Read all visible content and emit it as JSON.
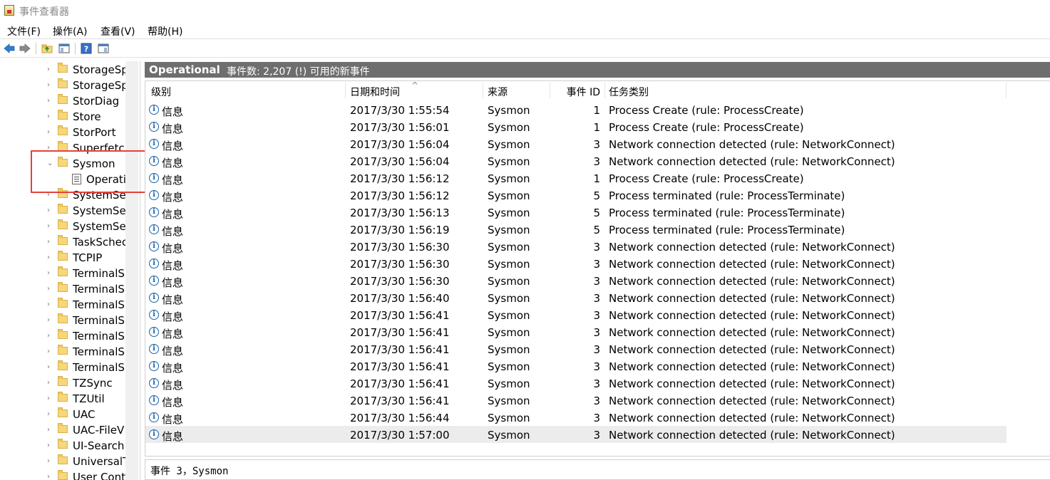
{
  "window": {
    "title": "事件查看器"
  },
  "menu": [
    "文件(F)",
    "操作(A)",
    "查看(V)",
    "帮助(H)"
  ],
  "toolbar": {
    "icons": [
      "back-arrow-icon",
      "forward-arrow-icon",
      "up-folder-icon",
      "show-hide-tree-icon",
      "help-icon",
      "show-hide-action-pane-icon"
    ]
  },
  "tree": {
    "items": [
      {
        "label": "StorageSp",
        "chevron": "›"
      },
      {
        "label": "StorageSp",
        "chevron": "›"
      },
      {
        "label": "StorDiag",
        "chevron": "›"
      },
      {
        "label": "Store",
        "chevron": "›"
      },
      {
        "label": "StorPort",
        "chevron": "›"
      },
      {
        "label": "Superfetc",
        "chevron": "›"
      },
      {
        "label": "Sysmon",
        "chevron": "⌄",
        "expanded": true
      },
      {
        "label": "Operati",
        "chevron": "",
        "selected": true
      },
      {
        "label": "SystemSe",
        "chevron": "›"
      },
      {
        "label": "SystemSet",
        "chevron": "›"
      },
      {
        "label": "SystemSe",
        "chevron": "›"
      },
      {
        "label": "TaskSchec",
        "chevron": "›"
      },
      {
        "label": "TCPIP",
        "chevron": "›"
      },
      {
        "label": "TerminalS",
        "chevron": "›"
      },
      {
        "label": "TerminalS",
        "chevron": "›"
      },
      {
        "label": "TerminalS",
        "chevron": "›"
      },
      {
        "label": "TerminalS",
        "chevron": "›"
      },
      {
        "label": "TerminalS",
        "chevron": "›"
      },
      {
        "label": "TerminalS",
        "chevron": "›"
      },
      {
        "label": "TerminalS",
        "chevron": "›"
      },
      {
        "label": "TZSync",
        "chevron": "›"
      },
      {
        "label": "TZUtil",
        "chevron": "›"
      },
      {
        "label": "UAC",
        "chevron": "›"
      },
      {
        "label": "UAC-FileV",
        "chevron": "›"
      },
      {
        "label": "UI-Search",
        "chevron": "›"
      },
      {
        "label": "UniversalT",
        "chevron": "›"
      },
      {
        "label": "User Cont",
        "chevron": "›"
      }
    ]
  },
  "header": {
    "title": "Operational",
    "info": "事件数: 2,207 (!) 可用的新事件"
  },
  "columns": [
    "级别",
    "日期和时间",
    "来源",
    "事件 ID",
    "任务类别"
  ],
  "sort_indicator": "^",
  "rows": [
    {
      "level": "信息",
      "datetime": "2017/3/30 1:55:54",
      "source": "Sysmon",
      "id": "1",
      "task": "Process Create (rule: ProcessCreate)"
    },
    {
      "level": "信息",
      "datetime": "2017/3/30 1:56:01",
      "source": "Sysmon",
      "id": "1",
      "task": "Process Create (rule: ProcessCreate)"
    },
    {
      "level": "信息",
      "datetime": "2017/3/30 1:56:04",
      "source": "Sysmon",
      "id": "3",
      "task": "Network connection detected (rule: NetworkConnect)"
    },
    {
      "level": "信息",
      "datetime": "2017/3/30 1:56:04",
      "source": "Sysmon",
      "id": "3",
      "task": "Network connection detected (rule: NetworkConnect)"
    },
    {
      "level": "信息",
      "datetime": "2017/3/30 1:56:12",
      "source": "Sysmon",
      "id": "1",
      "task": "Process Create (rule: ProcessCreate)"
    },
    {
      "level": "信息",
      "datetime": "2017/3/30 1:56:12",
      "source": "Sysmon",
      "id": "5",
      "task": "Process terminated (rule: ProcessTerminate)"
    },
    {
      "level": "信息",
      "datetime": "2017/3/30 1:56:13",
      "source": "Sysmon",
      "id": "5",
      "task": "Process terminated (rule: ProcessTerminate)"
    },
    {
      "level": "信息",
      "datetime": "2017/3/30 1:56:19",
      "source": "Sysmon",
      "id": "5",
      "task": "Process terminated (rule: ProcessTerminate)"
    },
    {
      "level": "信息",
      "datetime": "2017/3/30 1:56:30",
      "source": "Sysmon",
      "id": "3",
      "task": "Network connection detected (rule: NetworkConnect)"
    },
    {
      "level": "信息",
      "datetime": "2017/3/30 1:56:30",
      "source": "Sysmon",
      "id": "3",
      "task": "Network connection detected (rule: NetworkConnect)"
    },
    {
      "level": "信息",
      "datetime": "2017/3/30 1:56:30",
      "source": "Sysmon",
      "id": "3",
      "task": "Network connection detected (rule: NetworkConnect)"
    },
    {
      "level": "信息",
      "datetime": "2017/3/30 1:56:40",
      "source": "Sysmon",
      "id": "3",
      "task": "Network connection detected (rule: NetworkConnect)"
    },
    {
      "level": "信息",
      "datetime": "2017/3/30 1:56:41",
      "source": "Sysmon",
      "id": "3",
      "task": "Network connection detected (rule: NetworkConnect)"
    },
    {
      "level": "信息",
      "datetime": "2017/3/30 1:56:41",
      "source": "Sysmon",
      "id": "3",
      "task": "Network connection detected (rule: NetworkConnect)"
    },
    {
      "level": "信息",
      "datetime": "2017/3/30 1:56:41",
      "source": "Sysmon",
      "id": "3",
      "task": "Network connection detected (rule: NetworkConnect)"
    },
    {
      "level": "信息",
      "datetime": "2017/3/30 1:56:41",
      "source": "Sysmon",
      "id": "3",
      "task": "Network connection detected (rule: NetworkConnect)"
    },
    {
      "level": "信息",
      "datetime": "2017/3/30 1:56:41",
      "source": "Sysmon",
      "id": "3",
      "task": "Network connection detected (rule: NetworkConnect)"
    },
    {
      "level": "信息",
      "datetime": "2017/3/30 1:56:41",
      "source": "Sysmon",
      "id": "3",
      "task": "Network connection detected (rule: NetworkConnect)"
    },
    {
      "level": "信息",
      "datetime": "2017/3/30 1:56:44",
      "source": "Sysmon",
      "id": "3",
      "task": "Network connection detected (rule: NetworkConnect)"
    },
    {
      "level": "信息",
      "datetime": "2017/3/30 1:57:00",
      "source": "Sysmon",
      "id": "3",
      "task": "Network connection detected (rule: NetworkConnect)",
      "selected": true
    }
  ],
  "details": "事件 3，Sysmon",
  "colors": {
    "header_bg": "#6e6e6e",
    "highlight_box": "#e5413c",
    "info_icon": "#1b61a8",
    "selected_row": "#ececec"
  }
}
